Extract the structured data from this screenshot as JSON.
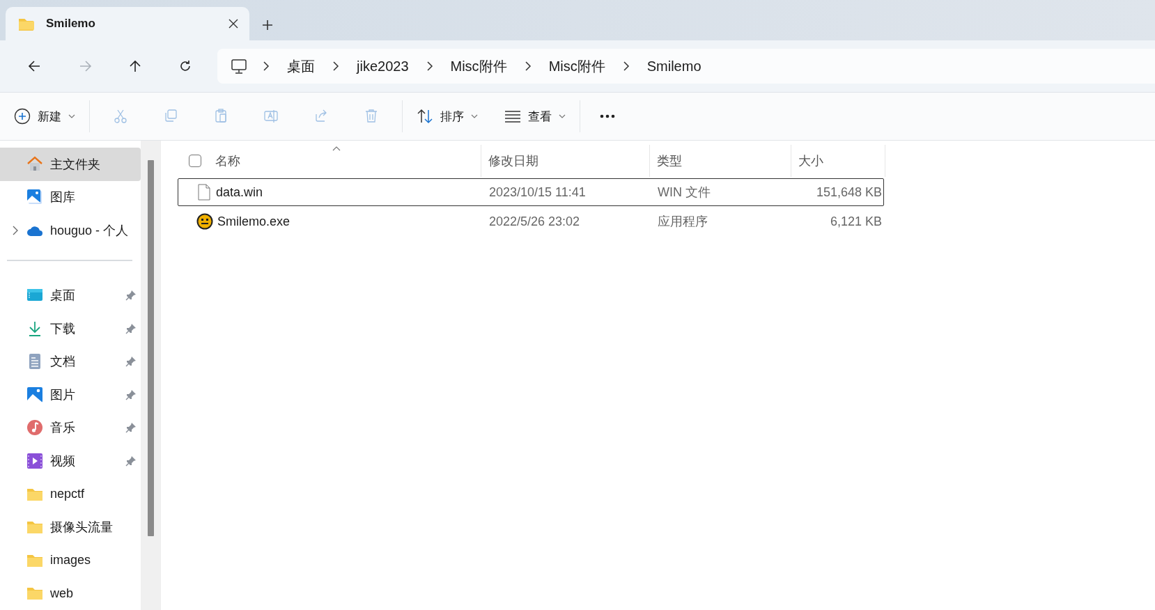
{
  "tab": {
    "title": "Smilemo",
    "selected": true
  },
  "nav": [
    {
      "kind": "back",
      "disabled": false
    },
    {
      "kind": "forward",
      "disabled": true
    },
    {
      "kind": "up",
      "disabled": false
    },
    {
      "kind": "refresh",
      "disabled": false
    }
  ],
  "breadcrumb": [
    "桌面",
    "jike2023",
    "Misc附件",
    "Misc附件",
    "Smilemo"
  ],
  "toolbar": {
    "new": {
      "label": "新建"
    },
    "actions": [
      {
        "kind": "cut",
        "disabled": true
      },
      {
        "kind": "copy",
        "disabled": true
      },
      {
        "kind": "paste",
        "disabled": true
      },
      {
        "kind": "rename",
        "disabled": true
      },
      {
        "kind": "share",
        "disabled": true
      },
      {
        "kind": "delete",
        "disabled": true
      }
    ],
    "sort": {
      "label": "排序"
    },
    "view": {
      "label": "查看"
    }
  },
  "sidebar": {
    "groups": [
      [
        {
          "label": "主文件夹",
          "kind": "home",
          "selected": true,
          "expandable": false,
          "pinned": false
        },
        {
          "label": "图库",
          "kind": "gallery",
          "selected": false,
          "expandable": false,
          "pinned": false
        },
        {
          "label": "houguo - 个人",
          "kind": "cloud",
          "selected": false,
          "expandable": true,
          "pinned": false
        }
      ],
      [
        {
          "label": "桌面",
          "kind": "desktop",
          "selected": false,
          "expandable": false,
          "pinned": true
        },
        {
          "label": "下载",
          "kind": "download",
          "selected": false,
          "expandable": false,
          "pinned": true
        },
        {
          "label": "文档",
          "kind": "document",
          "selected": false,
          "expandable": false,
          "pinned": true
        },
        {
          "label": "图片",
          "kind": "pictures",
          "selected": false,
          "expandable": false,
          "pinned": true
        },
        {
          "label": "音乐",
          "kind": "music",
          "selected": false,
          "expandable": false,
          "pinned": true
        },
        {
          "label": "视频",
          "kind": "video",
          "selected": false,
          "expandable": false,
          "pinned": true
        },
        {
          "label": "nepctf",
          "kind": "folder",
          "selected": false,
          "expandable": false,
          "pinned": false
        },
        {
          "label": "摄像头流量",
          "kind": "folder",
          "selected": false,
          "expandable": false,
          "pinned": false
        },
        {
          "label": "images",
          "kind": "folder",
          "selected": false,
          "expandable": false,
          "pinned": false
        },
        {
          "label": "web",
          "kind": "folder",
          "selected": false,
          "expandable": false,
          "pinned": false
        }
      ]
    ]
  },
  "table": {
    "select_all": {
      "checked": false
    },
    "columns": [
      {
        "label": "名称",
        "sorted": true
      },
      {
        "label": "修改日期",
        "sorted": false
      },
      {
        "label": "类型",
        "sorted": false
      },
      {
        "label": "大小",
        "sorted": false
      }
    ],
    "rows": [
      {
        "kind": "file",
        "name": "data.win",
        "date": "2023/10/15 11:41",
        "type": "WIN 文件",
        "size": "151,648 KB",
        "selected": true
      },
      {
        "kind": "app",
        "name": "Smilemo.exe",
        "date": "2022/5/26 23:02",
        "type": "应用程序",
        "size": "6,121 KB",
        "selected": false
      }
    ]
  }
}
